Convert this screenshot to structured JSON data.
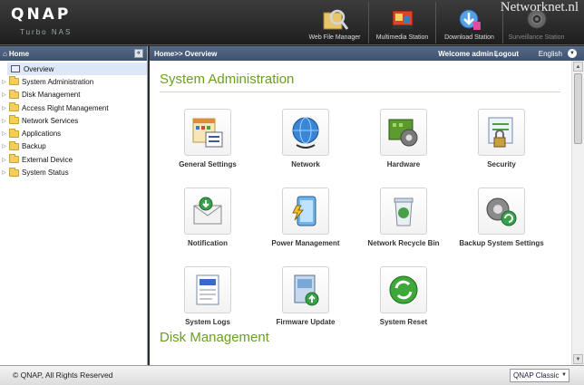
{
  "header": {
    "logo": "QNAP",
    "logo_sub": "Turbo NAS",
    "watermark": "Networknet.nl",
    "apps": [
      {
        "label": "Web File Manager",
        "icon": "web-file-manager-icon"
      },
      {
        "label": "Multimedia Station",
        "icon": "multimedia-station-icon"
      },
      {
        "label": "Download Station",
        "icon": "download-station-icon"
      },
      {
        "label": "Surveillance Station",
        "icon": "surveillance-station-icon"
      }
    ]
  },
  "sidebar": {
    "title": "Home",
    "collapse_symbol": "«",
    "items": [
      {
        "label": "Overview",
        "active": true
      },
      {
        "label": "System Administration"
      },
      {
        "label": "Disk Management"
      },
      {
        "label": "Access Right Management"
      },
      {
        "label": "Network Services"
      },
      {
        "label": "Applications"
      },
      {
        "label": "Backup"
      },
      {
        "label": "External Device"
      },
      {
        "label": "System Status"
      }
    ]
  },
  "topnav": {
    "breadcrumb": "Home>> Overview",
    "welcome": "Welcome admin",
    "separator": "|",
    "logout": "Logout",
    "language": "English"
  },
  "main": {
    "section_title": "System Administration",
    "tiles": [
      {
        "label": "General Settings",
        "icon": "general-settings-icon"
      },
      {
        "label": "Network",
        "icon": "network-globe-icon"
      },
      {
        "label": "Hardware",
        "icon": "hardware-gear-icon"
      },
      {
        "label": "Security",
        "icon": "security-lock-icon"
      },
      {
        "label": "Notification",
        "icon": "notification-envelope-icon"
      },
      {
        "label": "Power Management",
        "icon": "power-battery-icon"
      },
      {
        "label": "Network Recycle Bin",
        "icon": "recycle-bin-icon"
      },
      {
        "label": "Backup System Settings",
        "icon": "backup-settings-icon"
      },
      {
        "label": "System Logs",
        "icon": "system-logs-icon"
      },
      {
        "label": "Firmware Update",
        "icon": "firmware-update-icon"
      },
      {
        "label": "System Reset",
        "icon": "system-reset-icon"
      }
    ],
    "next_section_title": "Disk Management"
  },
  "footer": {
    "copyright": "© QNAP, All Rights Reserved",
    "theme": "QNAP Classic"
  },
  "colors": {
    "accent_green": "#6a9f1f",
    "header_blue": "#3e5271"
  }
}
